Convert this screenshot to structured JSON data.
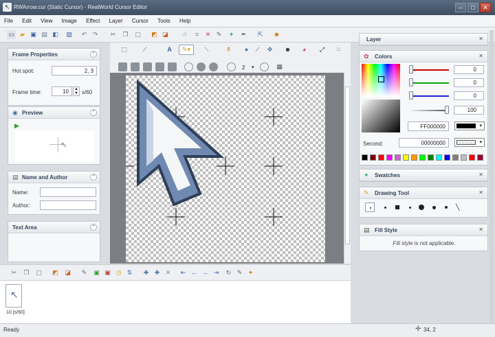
{
  "window": {
    "title": "RWArrow.cur (Static Cursor) - RealWorld Cursor Editor"
  },
  "menu": [
    "File",
    "Edit",
    "View",
    "Image",
    "Effect",
    "Layer",
    "Cursor",
    "Tools",
    "Help"
  ],
  "frame_properties": {
    "heading": "Frame Properties",
    "hotspot_label": "Hot spot:",
    "hotspot_value": "2, 3",
    "frametime_label": "Frame time:",
    "frametime_value": "10",
    "frametime_unit": "s/60"
  },
  "preview": {
    "heading": "Preview"
  },
  "name_author": {
    "heading": "Name and Author",
    "name_label": "Name:",
    "author_label": "Author:"
  },
  "text_area": {
    "heading": "Text Area"
  },
  "tool_options": {
    "brush_size": "2"
  },
  "frames": {
    "frame1_label": "10 [s/60]"
  },
  "layer_panel": {
    "heading": "Layer"
  },
  "colors_panel": {
    "heading": "Colors",
    "red": "0",
    "green": "0",
    "blue": "0",
    "alpha": "100",
    "hex": "FF000000",
    "second_label": "Second:",
    "second_hex": "00000000"
  },
  "swatches_panel": {
    "heading": "Swatches"
  },
  "drawing_tool_panel": {
    "heading": "Drawing Tool"
  },
  "fill_style_panel": {
    "heading": "Fill Style",
    "message": "Fill style is not applicable."
  },
  "status": {
    "text": "Ready",
    "coords": "34, 2"
  },
  "palette_colors": [
    "#000000",
    "#7f0000",
    "#ff0000",
    "#ff00ff",
    "#cc66cc",
    "#ffff00",
    "#ff9900",
    "#00ff00",
    "#008000",
    "#00ffff",
    "#0000ff",
    "#808080",
    "#c0c0c0",
    "#ff0000",
    "#990033"
  ]
}
